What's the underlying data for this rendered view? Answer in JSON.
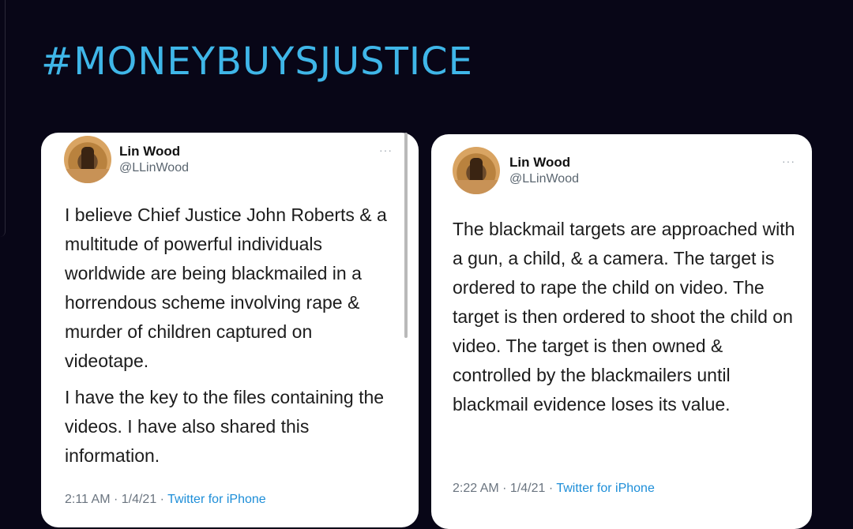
{
  "header": {
    "title": "#MONEYBUYSJUSTICE"
  },
  "tweets": [
    {
      "name": "Lin Wood",
      "handle": "@LLinWood",
      "more": "···",
      "paragraphs": [
        "I believe Chief Justice John Roberts & a multitude of powerful individuals worldwide are being blackmailed in a horrendous scheme involving rape & murder of children captured on videotape.",
        "I have the key to the files containing the videos. I have also shared this information."
      ],
      "time": "2:11 AM · 1/4/21 · ",
      "source": "Twitter for iPhone"
    },
    {
      "name": "Lin Wood",
      "handle": "@LLinWood",
      "more": "···",
      "paragraphs": [
        "The blackmail targets are approached with a gun, a child, & a camera. The target is ordered to rape the child on video. The target is then ordered to shoot the child on video. The target is then owned & controlled by the blackmailers until blackmail evidence loses its value."
      ],
      "time": "2:22 AM · 1/4/21 · ",
      "source": "Twitter for iPhone"
    }
  ]
}
